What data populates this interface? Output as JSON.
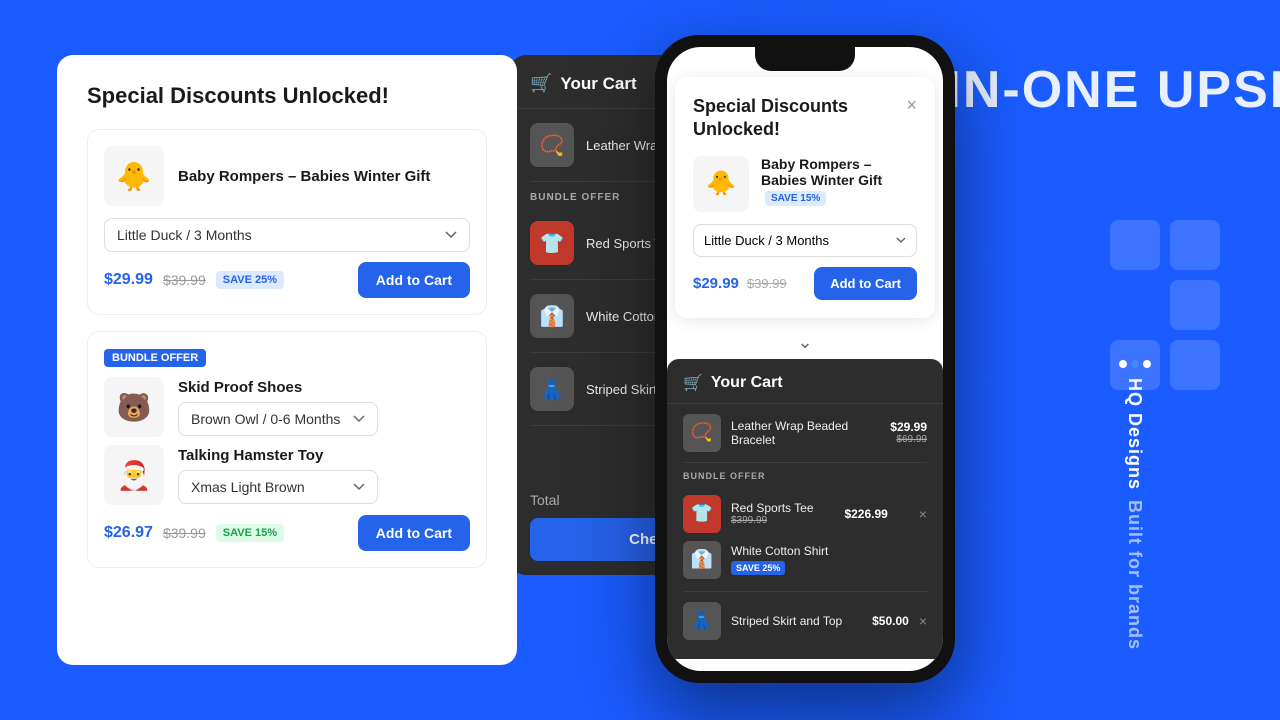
{
  "background": {
    "headline": "ALL-IN-ONE UPSELL I",
    "right_label": "Built for brands",
    "dot_label": "HQ Designs"
  },
  "left_panel": {
    "title": "Special Discounts Unlocked!",
    "product1": {
      "name": "Baby Rompers – Babies Winter Gift",
      "variant": "Little Duck / 3 Months",
      "price_new": "$29.99",
      "price_old": "$39.99",
      "save_badge": "SAVE 25%",
      "add_label": "Add to Cart",
      "emoji": "🐥"
    },
    "bundle_badge": "BUNDLE OFFER",
    "product2": {
      "name": "Skid Proof Shoes",
      "variant": "Brown Owl / 0-6 Months",
      "emoji": "🐻"
    },
    "product3": {
      "name": "Talking Hamster Toy",
      "variant": "Xmas Light Brown",
      "emoji": "🎅"
    },
    "bundle_price_new": "$26.97",
    "bundle_price_old": "$39.99",
    "bundle_save": "SAVE 15%",
    "bundle_add_label": "Add to Cart"
  },
  "cart_drawer": {
    "title": "Your Cart",
    "close": "×",
    "item1": {
      "name": "Leather Wrap Beaded Bracelet",
      "emoji": "📿"
    },
    "bundle_offer_label": "BUNDLE OFFER",
    "item2": {
      "name": "Red Sports Tee",
      "emoji": "👕"
    },
    "item3": {
      "name": "White Cotton Shirt",
      "emoji": "👔"
    },
    "item4": {
      "name": "Striped Skirt and To...",
      "emoji": "👗"
    },
    "total_label": "Total",
    "checkout_label": "Checki..."
  },
  "phone": {
    "modal": {
      "title": "Special Discounts Unlocked!",
      "close": "×",
      "product": {
        "name": "Baby Rompers – Babies Winter Gift",
        "save_badge": "SAVE 15%",
        "variant": "Little Duck / 3 Months",
        "price_new": "$29.99",
        "price_old": "$39.99",
        "add_label": "Add to Cart",
        "emoji": "🐥"
      }
    },
    "cart": {
      "title": "Your Cart",
      "item1": {
        "name": "Leather Wrap Beaded Bracelet",
        "price": "$29.99",
        "old_price": "$69.99",
        "emoji": "📿"
      },
      "bundle_label": "BUNDLE OFFER",
      "item2": {
        "name": "Red Sports Tee",
        "price": "$226.99",
        "old_price": "$399.99",
        "save": "SAVE 25%",
        "emoji": "👕"
      },
      "item3": {
        "name": "White Cotton Shirt",
        "emoji": "👔"
      },
      "item4": {
        "name": "Striped Skirt and Top",
        "price": "$50.00",
        "emoji": "👗"
      }
    }
  }
}
